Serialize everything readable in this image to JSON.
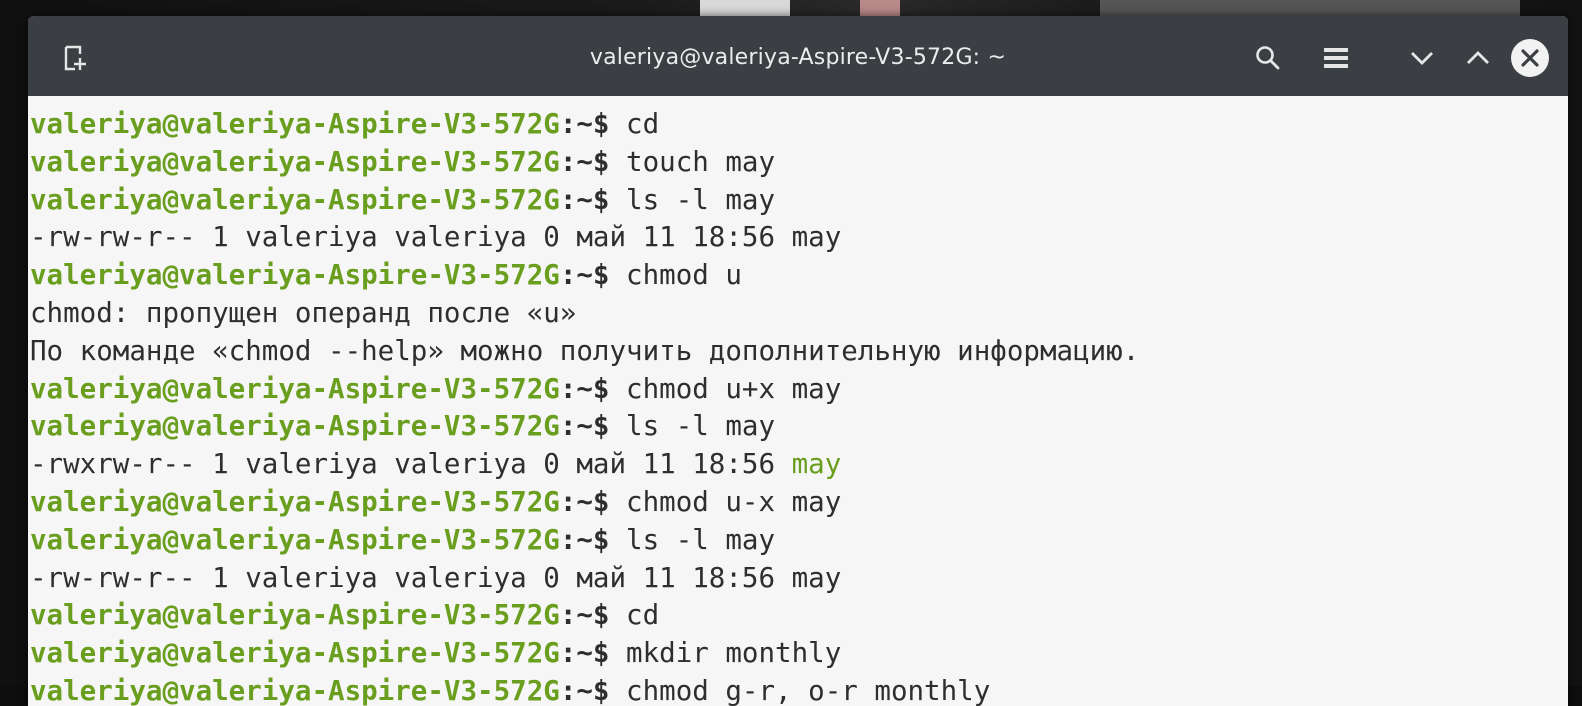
{
  "window": {
    "title": "valeriya@valeriya-Aspire-V3-572G: ~"
  },
  "titlebar": {
    "new_tab_icon": "new-tab-icon",
    "search_icon": "search-icon",
    "menu_icon": "hamburger-menu-icon",
    "minimize_icon": "chevron-down-icon",
    "maximize_icon": "chevron-up-icon",
    "close_icon": "close-icon"
  },
  "colors": {
    "prompt": "#6a9e1f",
    "text": "#2e2e2e",
    "titlebar": "#3b3e43",
    "background": "#f6f6f6"
  },
  "terminal": {
    "prompt_user": "valeriya@valeriya-Aspire-V3-572G",
    "prompt_sep": ":~$",
    "lines": [
      {
        "type": "cmd",
        "text": " cd"
      },
      {
        "type": "cmd",
        "text": " touch may"
      },
      {
        "type": "cmd",
        "text": " ls -l may"
      },
      {
        "type": "out",
        "text": "-rw-rw-r-- 1 valeriya valeriya 0 май 11 18:56 may"
      },
      {
        "type": "cmd",
        "text": " chmod u"
      },
      {
        "type": "out",
        "text": "chmod: пропущен операнд после «u»"
      },
      {
        "type": "out",
        "text": "По команде «chmod --help» можно получить дополнительную информацию."
      },
      {
        "type": "cmd",
        "text": " chmod u+x may"
      },
      {
        "type": "cmd",
        "text": " ls -l may"
      },
      {
        "type": "outhl",
        "text": "-rwxrw-r-- 1 valeriya valeriya 0 май 11 18:56 ",
        "hl": "may"
      },
      {
        "type": "cmd",
        "text": " chmod u-x may"
      },
      {
        "type": "cmd",
        "text": " ls -l may"
      },
      {
        "type": "out",
        "text": "-rw-rw-r-- 1 valeriya valeriya 0 май 11 18:56 may"
      },
      {
        "type": "cmd",
        "text": " cd"
      },
      {
        "type": "cmd",
        "text": " mkdir monthly"
      },
      {
        "type": "cmd",
        "text": " chmod g-r, o-r monthly"
      }
    ]
  }
}
